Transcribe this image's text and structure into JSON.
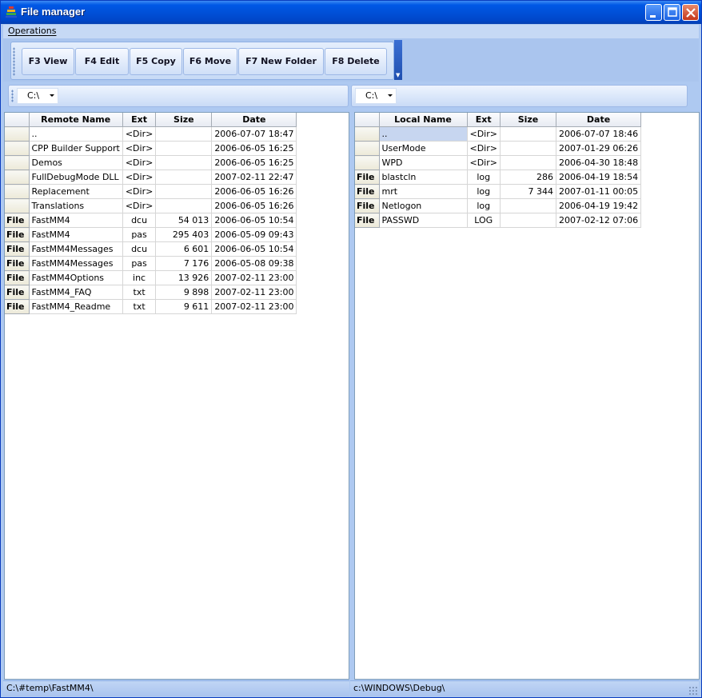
{
  "window": {
    "title": "File manager",
    "app_icon": "stack-icon"
  },
  "menubar": {
    "items": [
      "Operations"
    ]
  },
  "toolbar": {
    "buttons": [
      {
        "id": "view",
        "label": "F3 View"
      },
      {
        "id": "edit",
        "label": "F4 Edit"
      },
      {
        "id": "copy",
        "label": "F5 Copy"
      },
      {
        "id": "move",
        "label": "F6 Move"
      },
      {
        "id": "newfolder",
        "label": "F7 New Folder"
      },
      {
        "id": "delete",
        "label": "F8 Delete"
      }
    ]
  },
  "left_panel": {
    "drive": "C:\\",
    "columns": [
      "",
      "Remote Name",
      "Ext",
      "Size",
      "Date"
    ],
    "rows": [
      {
        "type": "",
        "name": "..",
        "ext": "<Dir>",
        "size": "",
        "date": "2006-07-07 18:47"
      },
      {
        "type": "",
        "name": "CPP Builder Support",
        "ext": "<Dir>",
        "size": "",
        "date": "2006-06-05 16:25"
      },
      {
        "type": "",
        "name": "Demos",
        "ext": "<Dir>",
        "size": "",
        "date": "2006-06-05 16:25"
      },
      {
        "type": "",
        "name": "FullDebugMode DLL",
        "ext": "<Dir>",
        "size": "",
        "date": "2007-02-11 22:47"
      },
      {
        "type": "",
        "name": "Replacement",
        "ext": "<Dir>",
        "size": "",
        "date": "2006-06-05 16:26"
      },
      {
        "type": "",
        "name": "Translations",
        "ext": "<Dir>",
        "size": "",
        "date": "2006-06-05 16:26"
      },
      {
        "type": "File",
        "name": "FastMM4",
        "ext": "dcu",
        "size": "54 013",
        "date": "2006-06-05 10:54"
      },
      {
        "type": "File",
        "name": "FastMM4",
        "ext": "pas",
        "size": "295 403",
        "date": "2006-05-09 09:43"
      },
      {
        "type": "File",
        "name": "FastMM4Messages",
        "ext": "dcu",
        "size": "6 601",
        "date": "2006-06-05 10:54"
      },
      {
        "type": "File",
        "name": "FastMM4Messages",
        "ext": "pas",
        "size": "7 176",
        "date": "2006-05-08 09:38"
      },
      {
        "type": "File",
        "name": "FastMM4Options",
        "ext": "inc",
        "size": "13 926",
        "date": "2007-02-11 23:00"
      },
      {
        "type": "File",
        "name": "FastMM4_FAQ",
        "ext": "txt",
        "size": "9 898",
        "date": "2007-02-11 23:00"
      },
      {
        "type": "File",
        "name": "FastMM4_Readme",
        "ext": "txt",
        "size": "9 611",
        "date": "2007-02-11 23:00"
      }
    ],
    "status": "C:\\#temp\\FastMM4\\"
  },
  "right_panel": {
    "drive": "C:\\",
    "columns": [
      "",
      "Local Name",
      "Ext",
      "Size",
      "Date"
    ],
    "rows": [
      {
        "type": "",
        "name": "..",
        "ext": "<Dir>",
        "size": "",
        "date": "2006-07-07 18:46"
      },
      {
        "type": "",
        "name": "UserMode",
        "ext": "<Dir>",
        "size": "",
        "date": "2007-01-29 06:26"
      },
      {
        "type": "",
        "name": "WPD",
        "ext": "<Dir>",
        "size": "",
        "date": "2006-04-30 18:48"
      },
      {
        "type": "File",
        "name": "blastcln",
        "ext": "log",
        "size": "286",
        "date": "2006-04-19 18:54"
      },
      {
        "type": "File",
        "name": "mrt",
        "ext": "log",
        "size": "7 344",
        "date": "2007-01-11 00:05"
      },
      {
        "type": "File",
        "name": "Netlogon",
        "ext": "log",
        "size": "",
        "date": "2006-04-19 19:42"
      },
      {
        "type": "File",
        "name": "PASSWD",
        "ext": "LOG",
        "size": "",
        "date": "2007-02-12 07:06"
      }
    ],
    "status": "c:\\WINDOWS\\Debug\\"
  },
  "colors": {
    "titlebar": "#0050d8",
    "frame": "#aec9f1",
    "selection": "#c7d6f0"
  }
}
